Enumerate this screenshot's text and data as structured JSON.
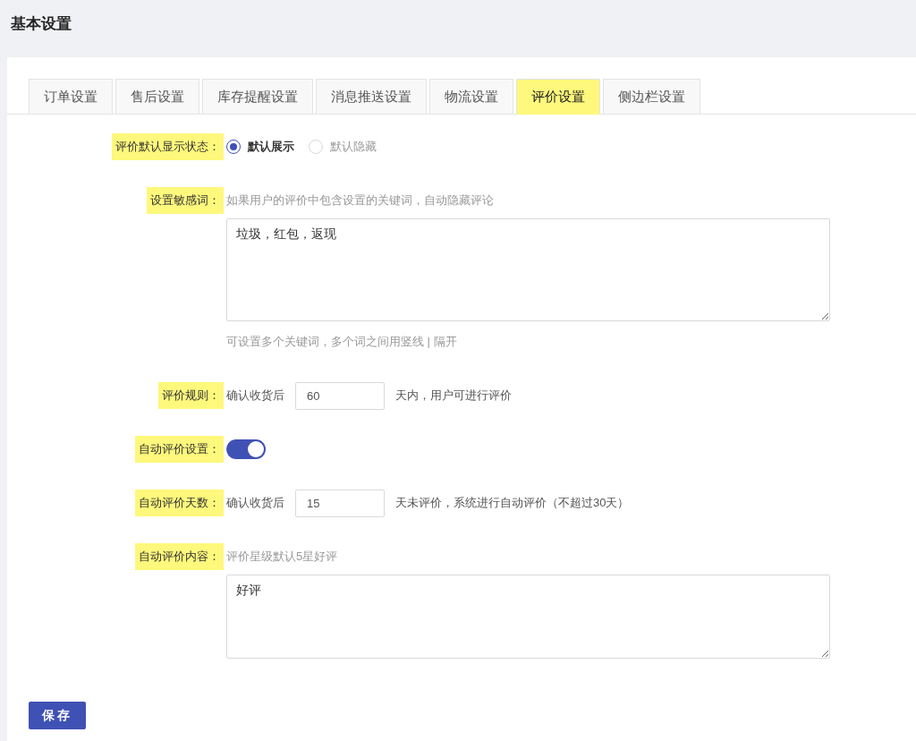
{
  "header": {
    "title": "基本设置"
  },
  "tabs": [
    {
      "label": "订单设置",
      "selected": false
    },
    {
      "label": "售后设置",
      "selected": false
    },
    {
      "label": "库存提醒设置",
      "selected": false
    },
    {
      "label": "消息推送设置",
      "selected": false
    },
    {
      "label": "物流设置",
      "selected": false
    },
    {
      "label": "评价设置",
      "selected": true
    },
    {
      "label": "侧边栏设置",
      "selected": false
    }
  ],
  "form": [
    {
      "kind": "radio",
      "label": "评价默认显示状态：",
      "options": [
        {
          "label": "默认展示",
          "selected": true
        },
        {
          "label": "默认隐藏",
          "selected": false
        }
      ]
    },
    {
      "kind": "textarea",
      "label": "设置敏感词：",
      "description": "如果用户的评价中包含设置的关键词，自动隐藏评论",
      "value": "垃圾，红包，返现",
      "hint": "可设置多个关键词，多个词之间用竖线 | 隔开"
    },
    {
      "kind": "inline_input",
      "label": "评价规则：",
      "prefix": "确认收货后",
      "value": "60",
      "suffix": "天内，用户可进行评价"
    },
    {
      "kind": "toggle",
      "label": "自动评价设置：",
      "on": true
    },
    {
      "kind": "inline_input",
      "label": "自动评价天数：",
      "prefix": "确认收货后",
      "value": "15",
      "suffix": "天未评价，系统进行自动评价（不超过30天）"
    },
    {
      "kind": "textarea",
      "label": "自动评价内容：",
      "description": "评价星级默认5星好评",
      "value": "好评"
    }
  ],
  "save_button": "保存"
}
